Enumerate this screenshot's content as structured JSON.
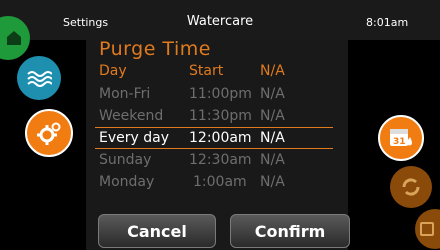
{
  "header": {
    "left_label": "Settings",
    "title": "Watercare",
    "time": "8:01am"
  },
  "panel": {
    "heading": "Purge Time",
    "columns": [
      "Day",
      "Start",
      "N/A"
    ],
    "rows": [
      {
        "day": "Mon-Fri",
        "start": "11:00pm",
        "na": "N/A",
        "selected": false
      },
      {
        "day": "Weekend",
        "start": "11:30pm",
        "na": "N/A",
        "selected": false
      },
      {
        "day": "Every day",
        "start": "12:00am",
        "na": "N/A",
        "selected": true
      },
      {
        "day": "Sunday",
        "start": "12:30am",
        "na": "N/A",
        "selected": false
      },
      {
        "day": "Monday",
        "start": "1:00am",
        "na": "N/A",
        "selected": false
      }
    ]
  },
  "buttons": {
    "cancel": "Cancel",
    "confirm": "Confirm"
  },
  "side_nav": {
    "left": [
      {
        "icon": "home-icon",
        "color": "#1f9a3a"
      },
      {
        "icon": "water-icon",
        "color": "#1f8fb0"
      },
      {
        "icon": "gear-icon",
        "color": "#f07c12"
      }
    ],
    "right": [
      {
        "icon": "calendar-icon",
        "label": "31",
        "color": "#f07c12"
      },
      {
        "icon": "cycle-icon",
        "color": "#8a4a0a"
      },
      {
        "icon": "calendar-partial-icon",
        "color": "#8a4a0a"
      }
    ]
  },
  "colors": {
    "accent": "#e07a1f",
    "text_dim": "#6e6e6e",
    "background": "#000000"
  }
}
